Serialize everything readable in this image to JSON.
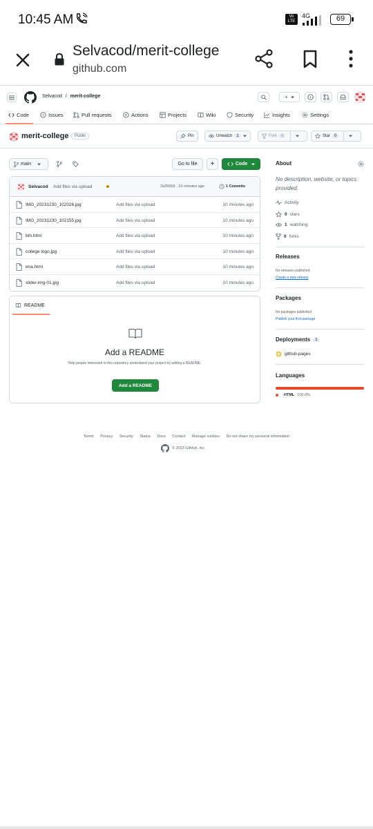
{
  "status_bar": {
    "time": "10:45 AM",
    "volte": "Vo LTE",
    "network": "4G",
    "battery": "69"
  },
  "browser": {
    "title": "Selvacod/merit-college",
    "url": "github.com"
  },
  "github_header": {
    "owner": "Selvacod",
    "separator": "/",
    "repo": "merit-college",
    "new_label": "+"
  },
  "tabs": [
    {
      "label": "Code"
    },
    {
      "label": "Issues"
    },
    {
      "label": "Pull requests"
    },
    {
      "label": "Actions"
    },
    {
      "label": "Projects"
    },
    {
      "label": "Wiki"
    },
    {
      "label": "Security"
    },
    {
      "label": "Insights"
    },
    {
      "label": "Settings"
    }
  ],
  "repo": {
    "name": "merit-college",
    "visibility": "Public",
    "pin": "Pin",
    "unwatch": "Unwatch",
    "watch_count": "1",
    "fork": "Fork",
    "fork_count": "0",
    "star": "Star",
    "star_count": "0"
  },
  "branch_bar": {
    "branch": "main",
    "go_to_file": "Go to file",
    "add": "+",
    "code": "Code"
  },
  "commit": {
    "author": "Selvacod",
    "message": "Add files via upload",
    "hash_time": "2a35559 · 10 minutes ago",
    "commits": "1 Commits"
  },
  "files": [
    {
      "name": "IMG_20231230_102026.jpg",
      "message": "Add files via upload",
      "time": "10 minutes ago"
    },
    {
      "name": "IMG_20231230_102155.jpg",
      "message": "Add files via upload",
      "time": "10 minutes ago"
    },
    {
      "name": "btn.html",
      "message": "Add files via upload",
      "time": "10 minutes ago"
    },
    {
      "name": "college logo.jpg",
      "message": "Add files via upload",
      "time": "10 minutes ago"
    },
    {
      "name": "ena.html",
      "message": "Add files via upload",
      "time": "10 minutes ago"
    },
    {
      "name": "slider-img-01.jpg",
      "message": "Add files via upload",
      "time": "10 minutes ago"
    }
  ],
  "readme": {
    "tab": "README",
    "title": "Add a README",
    "description": "Help people interested in this repository understand your project by adding a README.",
    "button": "Add a README"
  },
  "about": {
    "heading": "About",
    "description": "No description, website, or topics provided.",
    "activity": "Activity",
    "stars_count": "0",
    "stars_label": "stars",
    "watching_count": "1",
    "watching_label": "watching",
    "forks_count": "0",
    "forks_label": "forks"
  },
  "releases": {
    "heading": "Releases",
    "none": "No releases published",
    "link": "Create a new release"
  },
  "packages": {
    "heading": "Packages",
    "none": "No packages published",
    "link": "Publish your first package"
  },
  "deployments": {
    "heading": "Deployments",
    "count": "1",
    "item": "github-pages"
  },
  "languages": {
    "heading": "Languages",
    "items": [
      {
        "name": "HTML",
        "percent": "100.0%",
        "color": "#e34c26"
      }
    ]
  },
  "footer": {
    "links": [
      "Terms",
      "Privacy",
      "Security",
      "Status",
      "Docs",
      "Contact",
      "Manage cookies",
      "Do not share my personal information"
    ],
    "copyright": "© 2023 GitHub, Inc."
  },
  "colors": {
    "accent_green": "#1f883d",
    "tab_underline": "#fd8c73",
    "link": "#0969da"
  }
}
